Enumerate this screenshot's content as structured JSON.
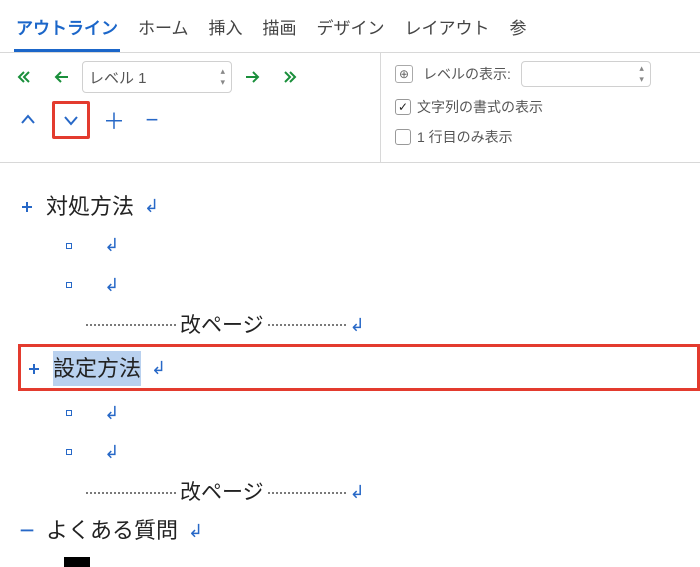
{
  "tabs": {
    "outline": "アウトライン",
    "home": "ホーム",
    "insert": "挿入",
    "draw": "描画",
    "design": "デザイン",
    "layout": "レイアウト",
    "references": "参"
  },
  "ribbon": {
    "level_select": "レベル 1",
    "show_level_label": "レベルの表示:",
    "show_level_value": "",
    "show_formatting": "文字列の書式の表示",
    "first_line_only": "1 行目のみ表示"
  },
  "doc": {
    "item1": "対処方法",
    "item2": "設定方法",
    "item3": "よくある質問",
    "pagebreak": "改ページ"
  }
}
